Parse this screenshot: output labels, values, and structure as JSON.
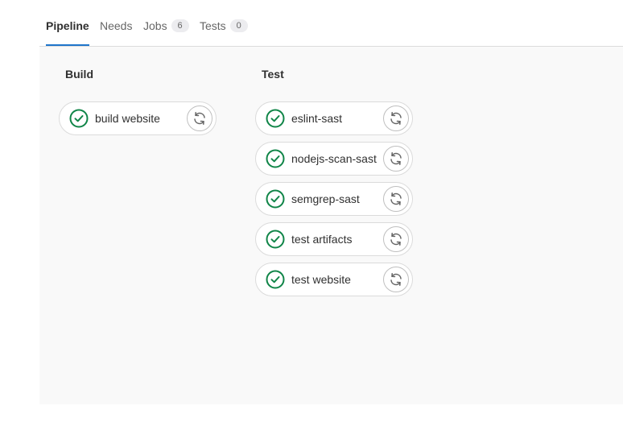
{
  "tabs": [
    {
      "label": "Pipeline"
    },
    {
      "label": "Needs"
    },
    {
      "label": "Jobs",
      "count": "6"
    },
    {
      "label": "Tests",
      "count": "0"
    }
  ],
  "stages": [
    {
      "title": "Build",
      "jobs": [
        {
          "name": "build website",
          "status": "success"
        }
      ]
    },
    {
      "title": "Test",
      "jobs": [
        {
          "name": "eslint-sast",
          "status": "success"
        },
        {
          "name": "nodejs-scan-sast",
          "status": "success"
        },
        {
          "name": "semgrep-sast",
          "status": "success"
        },
        {
          "name": "test artifacts",
          "status": "success"
        },
        {
          "name": "test website",
          "status": "success"
        }
      ]
    }
  ],
  "colors": {
    "success": "#108548",
    "active_tab_underline": "#1f75cb",
    "canvas_bg": "#f9f9f9"
  }
}
